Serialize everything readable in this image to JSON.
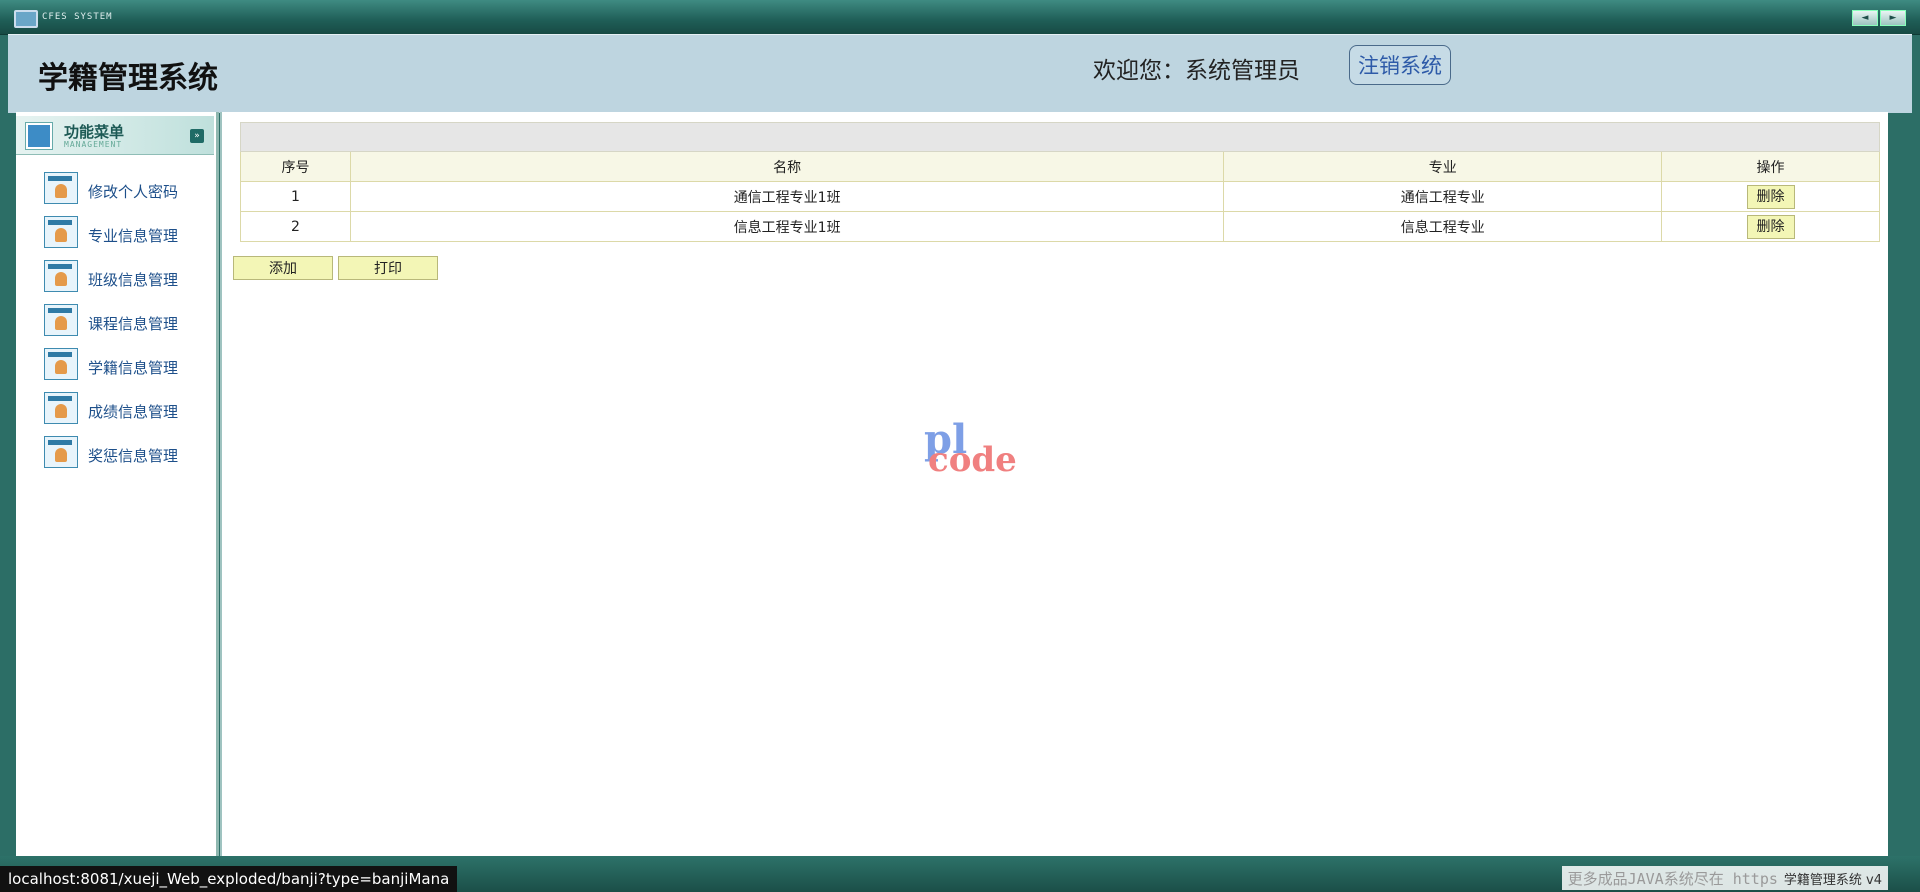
{
  "window": {
    "title": "CFES SYSTEM",
    "prev_label": "◄",
    "next_label": "►"
  },
  "header": {
    "system_title": "学籍管理系统",
    "welcome": "欢迎您：系统管理员",
    "logout_label": "注销系统"
  },
  "sidebar": {
    "menu_title": "功能菜单",
    "menu_subtitle": "MANAGEMENT",
    "items": [
      {
        "label": "修改个人密码"
      },
      {
        "label": "专业信息管理"
      },
      {
        "label": "班级信息管理"
      },
      {
        "label": "课程信息管理"
      },
      {
        "label": "学籍信息管理"
      },
      {
        "label": "成绩信息管理"
      },
      {
        "label": "奖惩信息管理"
      }
    ]
  },
  "table": {
    "columns": [
      "序号",
      "名称",
      "专业",
      "操作"
    ],
    "rows": [
      {
        "index": "1",
        "name": "通信工程专业1班",
        "major": "通信工程专业",
        "action": "删除"
      },
      {
        "index": "2",
        "name": "信息工程专业1班",
        "major": "信息工程专业",
        "action": "删除"
      }
    ]
  },
  "actions": {
    "add_label": "添加",
    "print_label": "打印"
  },
  "watermark": {
    "line1": "pl",
    "line2": "code"
  },
  "status": {
    "url": "localhost:8081/xueji_Web_exploded/banji?type=banjiMana"
  },
  "footer": {
    "note": "更多成品JAVA系统尽在 https",
    "app_name": "学籍管理系统 v4"
  },
  "colors": {
    "accent": "#2c6e66",
    "header_bg": "#bed5e0",
    "button_bg": "#f3f6b6"
  }
}
